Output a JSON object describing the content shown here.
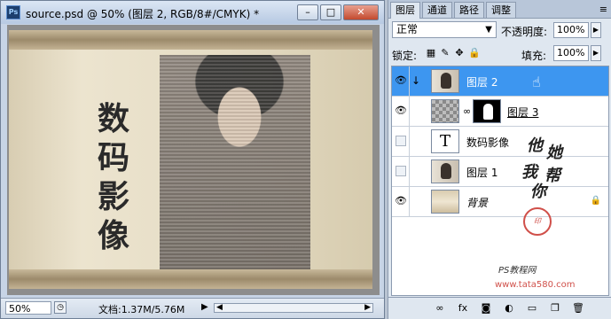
{
  "document": {
    "title": "source.psd @ 50% (图层 2, RGB/8#/CMYK) *",
    "app_icon_text": "Ps",
    "buttons": {
      "minimize": "–",
      "maximize": "□",
      "close": "✕"
    },
    "calligraphy": [
      "数",
      "码",
      "影",
      "像"
    ],
    "status": {
      "zoom": "50%",
      "doc_info": "文档:1.37M/5.76M",
      "arrow": "▶",
      "scroll_left": "◀",
      "scroll_right": "▶"
    }
  },
  "layers_panel": {
    "tabs": [
      "图层",
      "通道",
      "路径",
      "调整"
    ],
    "menu_icon": "≡",
    "blend_mode": "正常",
    "blend_dropdown": "▼",
    "opacity_label": "不透明度:",
    "opacity_value": "100%",
    "lock_label": "锁定:",
    "fill_label": "填充:",
    "fill_value": "100%",
    "stepper_arrow": "▶",
    "layers": [
      {
        "name": "图层 2",
        "visible": true,
        "selected": true,
        "clipped": true,
        "thumb": "portrait",
        "eye": "👁",
        "clip_arrow": "↓",
        "cursor": "☝"
      },
      {
        "name": "图层 3",
        "visible": true,
        "selected": false,
        "thumb": "checker",
        "mask": true,
        "eye": "👁",
        "link": "∞"
      },
      {
        "name": "数码影像",
        "visible": false,
        "selected": false,
        "thumb": "text",
        "thumb_text": "T"
      },
      {
        "name": "图层 1",
        "visible": false,
        "selected": false,
        "thumb": "portrait"
      },
      {
        "name": "背景",
        "visible": true,
        "selected": false,
        "thumb": "background",
        "eye": "👁",
        "lock": "🔒"
      }
    ],
    "watermark": {
      "chars": [
        "他",
        "她",
        "我",
        "帮",
        "你"
      ],
      "seal": "印",
      "site_text": "PS教程网",
      "url": "www.tata580.com"
    },
    "footer_icons": [
      "link-icon",
      "fx-icon",
      "mask-icon",
      "adjustment-icon",
      "group-icon",
      "new-layer-icon",
      "delete-icon"
    ],
    "footer_glyphs": [
      "∞",
      "fx",
      "◙",
      "◐",
      "▭",
      "❐",
      "🗑"
    ]
  }
}
